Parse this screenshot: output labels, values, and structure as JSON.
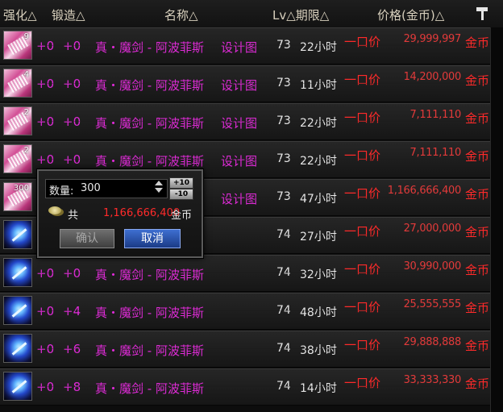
{
  "header": {
    "strengthen": "强化△",
    "forge": "锻造△",
    "name": "名称△",
    "lv_limit": "Lv△期限△",
    "price": "价格(金币)△"
  },
  "rows": [
    {
      "icon": "scroll",
      "qty": "9",
      "strengthen": "+0",
      "forge": "+0",
      "name": "真・魔剑 - 阿波菲斯",
      "blueprint": "设计图",
      "lv": "73",
      "time": "22小时",
      "type": "一口价",
      "price": "29,999,997",
      "currency": "金币"
    },
    {
      "icon": "scroll",
      "qty": "4",
      "strengthen": "+0",
      "forge": "+0",
      "name": "真・魔剑 - 阿波菲斯",
      "blueprint": "设计图",
      "lv": "73",
      "time": "11小时",
      "type": "一口价",
      "price": "14,200,000",
      "currency": "金币"
    },
    {
      "icon": "scroll",
      "qty": "2",
      "strengthen": "+0",
      "forge": "+0",
      "name": "真・魔剑 - 阿波菲斯",
      "blueprint": "设计图",
      "lv": "73",
      "time": "22小时",
      "type": "一口价",
      "price": "7,111,110",
      "currency": "金币"
    },
    {
      "icon": "scroll",
      "qty": "2",
      "strengthen": "+0",
      "forge": "+0",
      "name": "真・魔剑 - 阿波菲斯",
      "blueprint": "设计图",
      "lv": "73",
      "time": "22小时",
      "type": "一口价",
      "price": "7,111,110",
      "currency": "金币"
    },
    {
      "icon": "scroll",
      "qty": "300",
      "strengthen": "",
      "forge": "",
      "name": "",
      "blueprint": "设计图",
      "lv": "73",
      "time": "47小时",
      "type": "一口价",
      "price": "1,166,666,400",
      "currency": "金币"
    },
    {
      "icon": "sword",
      "qty": "",
      "strengthen": "",
      "forge": "",
      "name": "",
      "blueprint": "",
      "lv": "74",
      "time": "27小时",
      "type": "一口价",
      "price": "27,000,000",
      "currency": "金币"
    },
    {
      "icon": "sword",
      "qty": "",
      "strengthen": "+0",
      "forge": "+0",
      "name": "真・魔剑 - 阿波菲斯",
      "blueprint": "",
      "lv": "74",
      "time": "32小时",
      "type": "一口价",
      "price": "30,990,000",
      "currency": "金币"
    },
    {
      "icon": "sword",
      "qty": "",
      "strengthen": "+0",
      "forge": "+4",
      "name": "真・魔剑 - 阿波菲斯",
      "blueprint": "",
      "lv": "74",
      "time": "48小时",
      "type": "一口价",
      "price": "25,555,555",
      "currency": "金币"
    },
    {
      "icon": "sword",
      "qty": "",
      "strengthen": "+0",
      "forge": "+6",
      "name": "真・魔剑 - 阿波菲斯",
      "blueprint": "",
      "lv": "74",
      "time": "38小时",
      "type": "一口价",
      "price": "29,888,888",
      "currency": "金币"
    },
    {
      "icon": "sword",
      "qty": "",
      "strengthen": "+0",
      "forge": "+8",
      "name": "真・魔剑 - 阿波菲斯",
      "blueprint": "",
      "lv": "74",
      "time": "14小时",
      "type": "一口价",
      "price": "33,333,330",
      "currency": "金币"
    }
  ],
  "dialog": {
    "qty_label": "数量:",
    "qty_value": "300",
    "plus10": "+10",
    "minus10": "-10",
    "total_label": "共",
    "total_value": "1,166,666,400",
    "total_currency": "金币",
    "confirm": "确认",
    "cancel": "取消"
  },
  "colors": {
    "item_text": "#e02bd8",
    "price_red": "#ff2a2a",
    "header_text": "#d8d0bd",
    "cancel_blue": "#2b56b8"
  }
}
